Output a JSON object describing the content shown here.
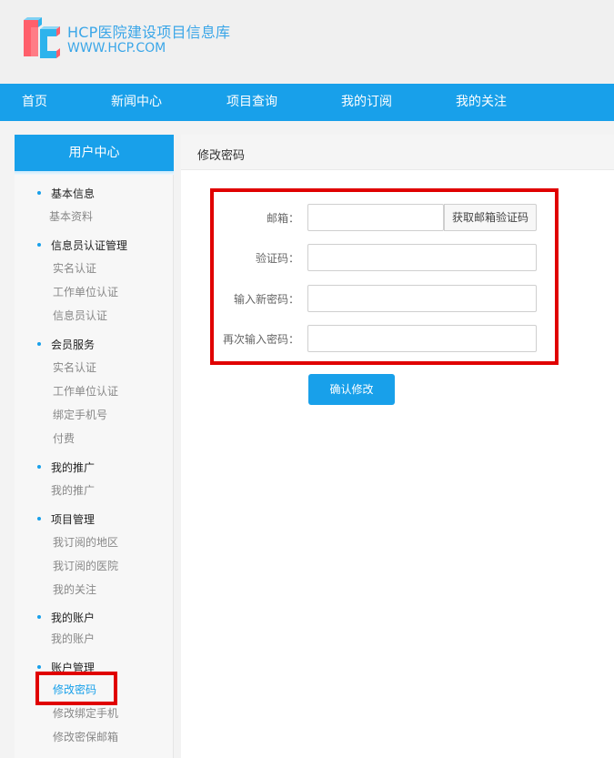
{
  "brand": {
    "title": "HCP医院建设项目信息库",
    "url": "WWW.HCP.COM"
  },
  "nav": {
    "items": [
      "首页",
      "新闻中心",
      "项目查询",
      "我的订阅",
      "我的关注"
    ]
  },
  "sidebar": {
    "header": "用户中心",
    "sections": [
      {
        "title": "基本信息",
        "items": [
          "基本资料"
        ]
      },
      {
        "title": "信息员认证管理",
        "items": [
          "实名认证",
          "工作单位认证",
          "信息员认证"
        ]
      },
      {
        "title": "会员服务",
        "items": [
          "实名认证",
          "工作单位认证",
          "绑定手机号",
          "付费"
        ]
      },
      {
        "title": "我的推广",
        "items": [
          "我的推广"
        ]
      },
      {
        "title": "项目管理",
        "items": [
          "我订阅的地区",
          "我订阅的医院",
          "我的关注"
        ]
      },
      {
        "title": "我的账户",
        "items": [
          "我的账户"
        ]
      },
      {
        "title": "账户管理",
        "items": [
          "修改密码",
          "修改绑定手机",
          "修改密保邮箱"
        ]
      }
    ]
  },
  "main": {
    "title": "修改密码",
    "form": {
      "email_label": "邮箱：",
      "email_value": "",
      "get_code_button": "获取邮箱验证码",
      "code_label": "验证码：",
      "code_value": "",
      "new_password_label": "输入新密码：",
      "new_password_value": "",
      "confirm_password_label": "再次输入密码：",
      "confirm_password_value": "",
      "submit_button": "确认修改"
    }
  },
  "colors": {
    "accent": "#18a0ea",
    "highlight": "#e00000"
  }
}
